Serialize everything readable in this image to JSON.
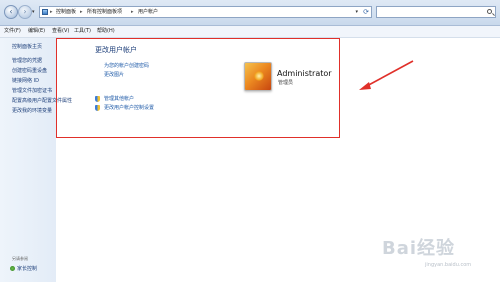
{
  "address_bar": {
    "crumbs": [
      "控制面板",
      "所有控制面板项",
      "用户帐户"
    ],
    "search_placeholder": ""
  },
  "menu": [
    "文件(F)",
    "编辑(E)",
    "查看(V)",
    "工具(T)",
    "帮助(H)"
  ],
  "sidebar": {
    "home": "控制面板主页",
    "items": [
      "管理您的凭据",
      "创建密码重设盘",
      "链接网络 ID",
      "管理文件加密证书",
      "配置高级用户配置文件属性",
      "更改我的环境变量"
    ],
    "see_also": "另请参阅",
    "family": "家长控制"
  },
  "main": {
    "title": "更改用户帐户",
    "links": [
      "为您的帐户创建密码",
      "更改图片"
    ],
    "admin_links": [
      "管理其他帐户",
      "更改用户帐户控制设置"
    ]
  },
  "user": {
    "name": "Administrator",
    "role": "管理员"
  },
  "annotation_color": "#e0302a",
  "watermark": {
    "brand": "Bai经验",
    "url": "jingyan.baidu.com"
  }
}
